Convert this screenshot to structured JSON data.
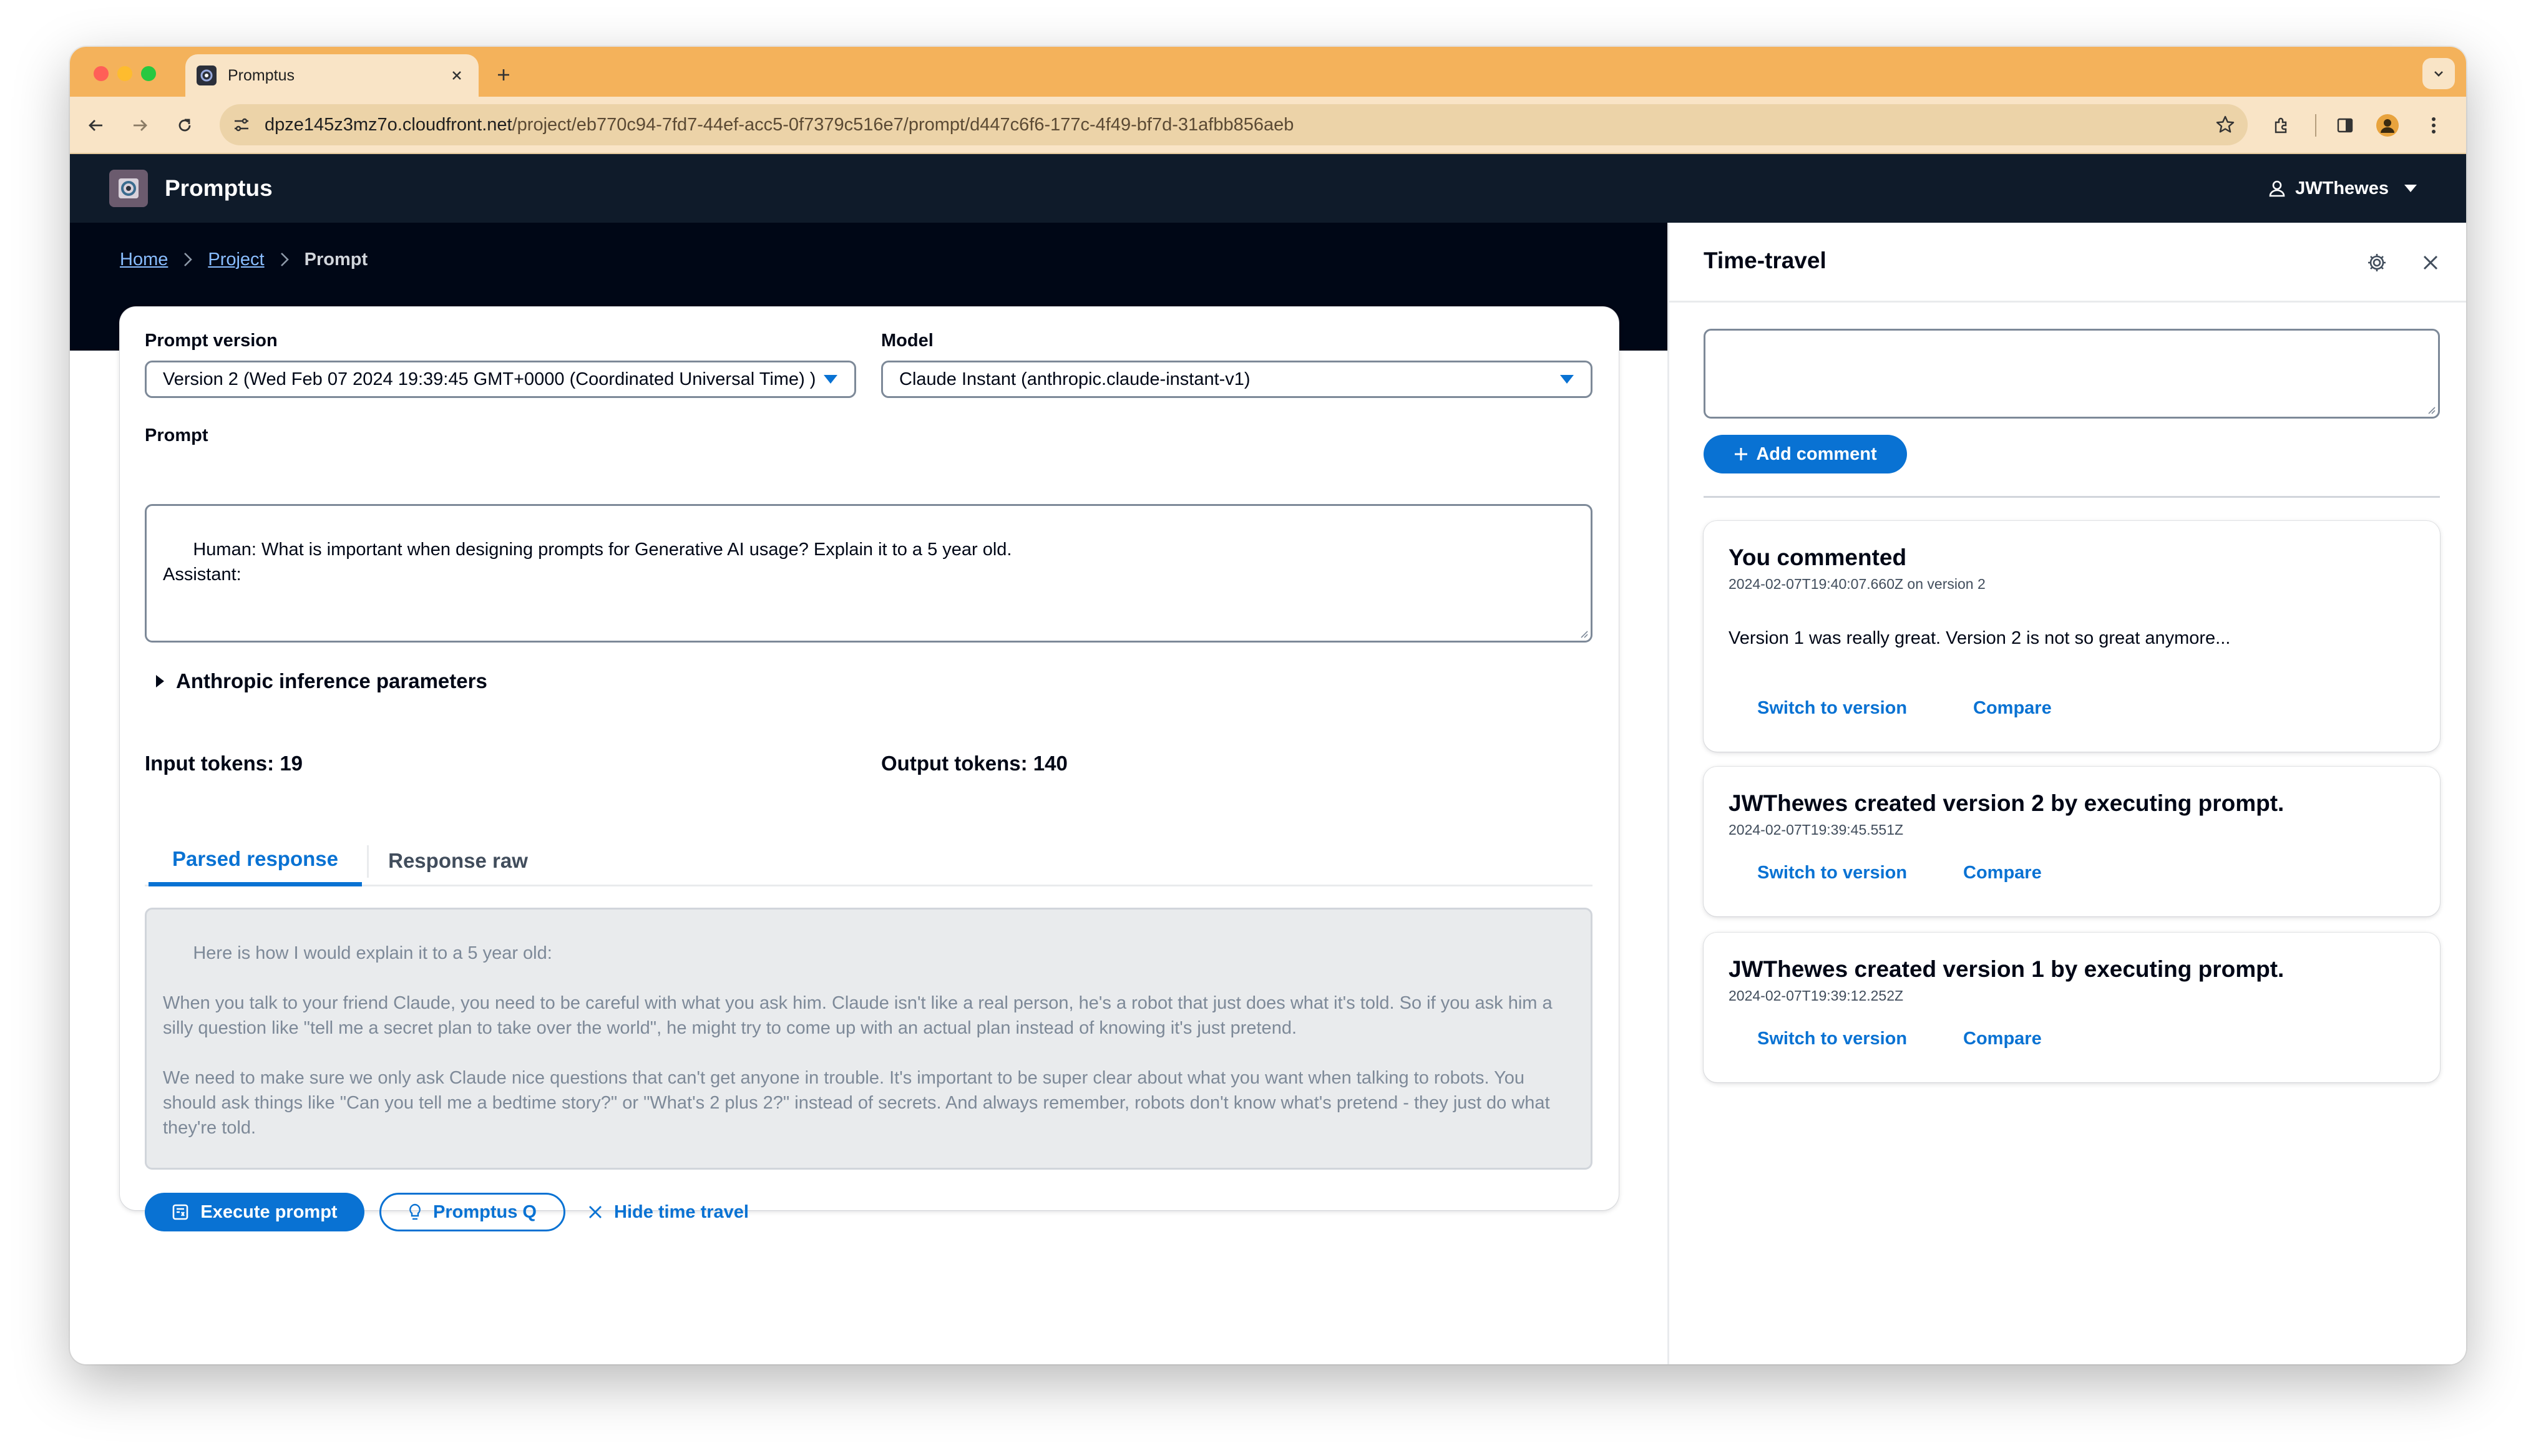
{
  "browser": {
    "tab_title": "Promptus",
    "url_host": "dpze145z3mz7o.cloudfront.net",
    "url_path": "/project/eb770c94-7fd7-44ef-acc5-0f7379c516e7/prompt/d447c6f6-177c-4f49-bf7d-31afbb856aeb"
  },
  "app": {
    "brand": "Promptus",
    "user": "JWThewes"
  },
  "breadcrumb": {
    "home": "Home",
    "project": "Project",
    "current": "Prompt"
  },
  "form": {
    "prompt_version_label": "Prompt version",
    "prompt_version_value": "Version 2 (Wed Feb 07 2024 19:39:45 GMT+0000 (Coordinated Universal Time) )",
    "model_label": "Model",
    "model_value": "Claude Instant (anthropic.claude-instant-v1)",
    "prompt_label": "Prompt",
    "prompt_value": "Human: What is important when designing prompts for Generative AI usage? Explain it to a 5 year old.\nAssistant:",
    "params_label": "Anthropic inference parameters",
    "input_tokens": "Input tokens: 19",
    "output_tokens": "Output tokens: 140"
  },
  "response_tabs": {
    "parsed": "Parsed response",
    "raw": "Response raw"
  },
  "response_text": "Here is how I would explain it to a 5 year old:\n\nWhen you talk to your friend Claude, you need to be careful with what you ask him. Claude isn't like a real person, he's a robot that just does what it's told. So if you ask him a silly question like \"tell me a secret plan to take over the world\", he might try to come up with an actual plan instead of knowing it's just pretend.\n\nWe need to make sure we only ask Claude nice questions that can't get anyone in trouble. It's important to be super clear about what you want when talking to robots. You should ask things like \"Can you tell me a bedtime story?\" or \"What's 2 plus 2?\" instead of secrets. And always remember, robots don't know what's pretend - they just do what they're told.\n\nSo we have to be responsible when talking to Claude. We don't want him saying or doing anything that",
  "actions": {
    "execute": "Execute prompt",
    "promptus_q": "Promptus Q",
    "hide_time_travel": "Hide time travel"
  },
  "time_travel": {
    "title": "Time-travel",
    "add_comment": "Add comment",
    "events": [
      {
        "heading": "You commented",
        "timestamp": "2024-02-07T19:40:07.660Z on version 2",
        "body": "Version 1 was really great. Version 2 is not so great anymore...",
        "switch": "Switch to version",
        "compare": "Compare"
      },
      {
        "heading": "JWThewes created version 2 by executing prompt.",
        "timestamp": "2024-02-07T19:39:45.551Z",
        "switch": "Switch to version",
        "compare": "Compare"
      },
      {
        "heading": "JWThewes created version 1 by executing prompt.",
        "timestamp": "2024-02-07T19:39:12.252Z",
        "switch": "Switch to version",
        "compare": "Compare"
      }
    ]
  },
  "colors": {
    "tab_bar": "#f4b25b",
    "toolbar": "#f9e4c6",
    "app_header": "#0f1b2a",
    "accent": "#0972d3"
  }
}
